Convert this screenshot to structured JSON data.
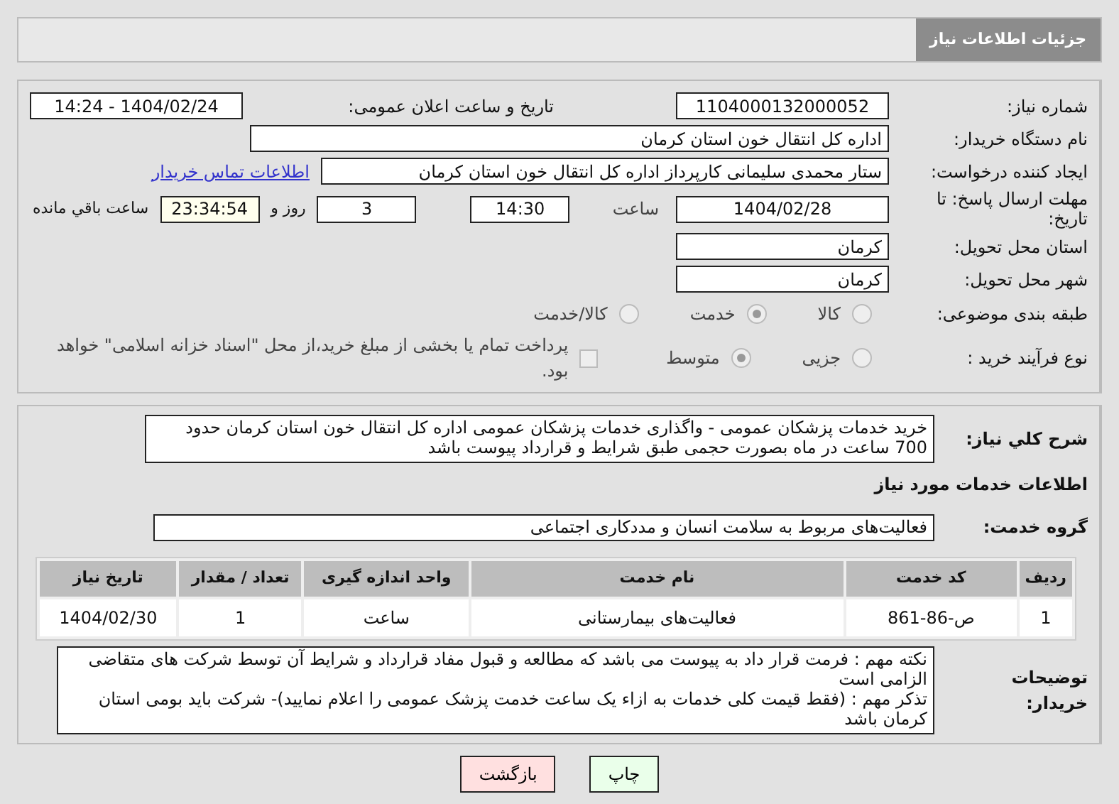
{
  "header": {
    "title": "جزئیات اطلاعات نیاز"
  },
  "need_info": {
    "need_number": {
      "label": "شماره نیاز:",
      "value": "1104000132000052"
    },
    "announce": {
      "label": "تاریخ و ساعت اعلان عمومی:",
      "value": "1404/02/24 - 14:24"
    },
    "buyer_org": {
      "label": "نام دستگاه خریدار:",
      "value": "اداره کل انتقال خون استان کرمان"
    },
    "creator": {
      "label": "ایجاد کننده درخواست:",
      "value": "ستار محمدی سلیمانی کارپرداز اداره کل انتقال خون استان کرمان",
      "link": "اطلاعات تماس خریدار"
    },
    "deadline": {
      "label": "مهلت ارسال پاسخ: تا تاریخ:",
      "date": "1404/02/28",
      "time_label": "ساعت",
      "time": "14:30",
      "days": "3",
      "days_label": "روز و",
      "remaining": "23:34:54",
      "remaining_label": "ساعت باقي مانده"
    },
    "province": {
      "label": "استان محل تحویل:",
      "value": "کرمان"
    },
    "city": {
      "label": "شهر محل تحویل:",
      "value": "کرمان"
    },
    "category": {
      "label": "طبقه بندی موضوعی:",
      "options": [
        {
          "label": "کالا",
          "selected": false
        },
        {
          "label": "خدمت",
          "selected": true
        },
        {
          "label": "کالا/خدمت",
          "selected": false
        }
      ]
    },
    "process": {
      "label": "نوع فرآیند خرید :",
      "options": [
        {
          "label": "جزیی",
          "selected": false
        },
        {
          "label": "متوسط",
          "selected": true
        }
      ],
      "payment": {
        "checked": false,
        "label": "پرداخت تمام یا بخشی از مبلغ خرید،از محل \"اسناد خزانه اسلامی\" خواهد بود."
      }
    }
  },
  "details": {
    "description": {
      "label": "شرح کلي نیاز:",
      "value": "خرید خدمات پزشکان عمومی - واگذاری خدمات پزشکان عمومی اداره کل انتقال خون استان کرمان حدود 700 ساعت در ماه بصورت حجمی طبق شرایط و قرارداد پیوست باشد"
    },
    "section_title": "اطلاعات خدمات مورد نیاز",
    "service_group": {
      "label": "گروه خدمت:",
      "value": "فعالیت‌های مربوط به سلامت انسان و مددکاری اجتماعی"
    },
    "table": {
      "columns": [
        "ردیف",
        "کد خدمت",
        "نام خدمت",
        "واحد اندازه گیری",
        "تعداد / مقدار",
        "تاریخ نیاز"
      ],
      "rows": [
        [
          "1",
          "ص-86-861",
          "فعالیت‌های بیمارستانی",
          "ساعت",
          "1",
          "1404/02/30"
        ]
      ]
    },
    "buyer_notes": {
      "label": "توضیحات خریدار:",
      "value": "نکته مهم : فرمت قرار داد به پیوست می باشد که مطالعه و قبول مفاد قرارداد و شرایط آن توسط شرکت های متقاضی الزامی است\nتذکر مهم : (فقط قیمت کلی خدمات به ازاء یک ساعت خدمت پزشک عمومی را اعلام نمایید)- شرکت باید بومی استان کرمان باشد"
    }
  },
  "buttons": [
    {
      "label": "چاپ",
      "kind": "print"
    },
    {
      "label": "بازگشت",
      "kind": "back"
    }
  ]
}
